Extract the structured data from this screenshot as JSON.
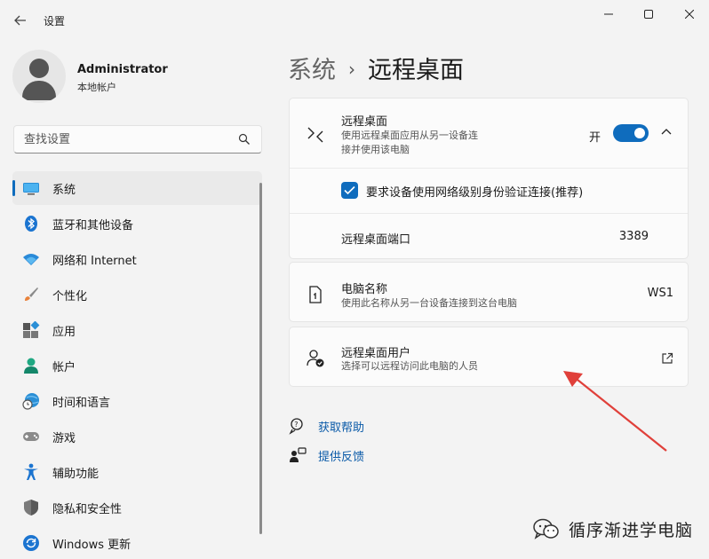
{
  "window": {
    "title": "设置",
    "back_icon": "back-arrow-icon",
    "controls": [
      "minimize-icon",
      "maximize-icon",
      "close-icon"
    ]
  },
  "profile": {
    "name": "Administrator",
    "account_type": "本地帐户"
  },
  "search": {
    "placeholder": "查找设置"
  },
  "sidebar": {
    "items": [
      {
        "label": "系统",
        "icon": "monitor-icon",
        "active": true
      },
      {
        "label": "蓝牙和其他设备",
        "icon": "bluetooth-icon"
      },
      {
        "label": "网络和 Internet",
        "icon": "wifi-icon"
      },
      {
        "label": "个性化",
        "icon": "paintbrush-icon"
      },
      {
        "label": "应用",
        "icon": "apps-icon"
      },
      {
        "label": "帐户",
        "icon": "person-icon"
      },
      {
        "label": "时间和语言",
        "icon": "globe-clock-icon"
      },
      {
        "label": "游戏",
        "icon": "gamepad-icon"
      },
      {
        "label": "辅助功能",
        "icon": "accessibility-icon"
      },
      {
        "label": "隐私和安全性",
        "icon": "shield-icon"
      },
      {
        "label": "Windows 更新",
        "icon": "update-icon"
      }
    ]
  },
  "breadcrumb": {
    "parent": "系统",
    "separator": "›",
    "current": "远程桌面"
  },
  "remote_desktop": {
    "title": "远程桌面",
    "description_line1": "使用远程桌面应用从另一设备连",
    "description_line2": "接并使用该电脑",
    "toggle_label": "开",
    "enabled": true,
    "nla_checkbox_label": "要求设备使用网络级别身份验证连接(推荐)",
    "nla_checked": true,
    "port_label": "远程桌面端口",
    "port_value": "3389"
  },
  "pc_name": {
    "title": "电脑名称",
    "description": "使用此名称从另一台设备连接到这台电脑",
    "value": "WS1"
  },
  "remote_users": {
    "title": "远程桌面用户",
    "description": "选择可以远程访问此电脑的人员"
  },
  "help_links": {
    "get_help": "获取帮助",
    "feedback": "提供反馈"
  },
  "watermark": {
    "text": "循序渐进学电脑"
  },
  "colors": {
    "accent": "#0f6cbd",
    "background": "#f3f3f3",
    "card": "#fbfbfb",
    "annotation_arrow": "#e0403a"
  }
}
